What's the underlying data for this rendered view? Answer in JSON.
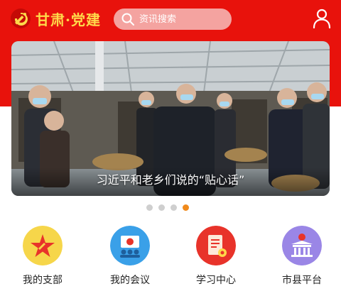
{
  "colors": {
    "header_red": "#e8120c",
    "logo_gold": "#ffd94a",
    "dot_active": "#f08a1c",
    "dot_inactive": "#cfcfcf"
  },
  "header": {
    "logo_text": "甘肃·党建",
    "logo_icon": "party-emblem-icon",
    "search": {
      "placeholder": "资讯搜索",
      "icon": "search-icon"
    },
    "user_icon": "user-profile-icon"
  },
  "banner": {
    "caption": "习近平和老乡们说的“贴心话”",
    "slide_count": 4,
    "active_slide": 4
  },
  "quick_nav": [
    {
      "label": "我的支部",
      "icon": "party-star-icon",
      "color": "#f6d64a"
    },
    {
      "label": "我的会议",
      "icon": "meeting-icon",
      "color": "#3aa0e8"
    },
    {
      "label": "学习中心",
      "icon": "study-book-icon",
      "color": "#e8332a"
    },
    {
      "label": "市县平台",
      "icon": "government-building-icon",
      "color": "#9a86e6"
    }
  ]
}
